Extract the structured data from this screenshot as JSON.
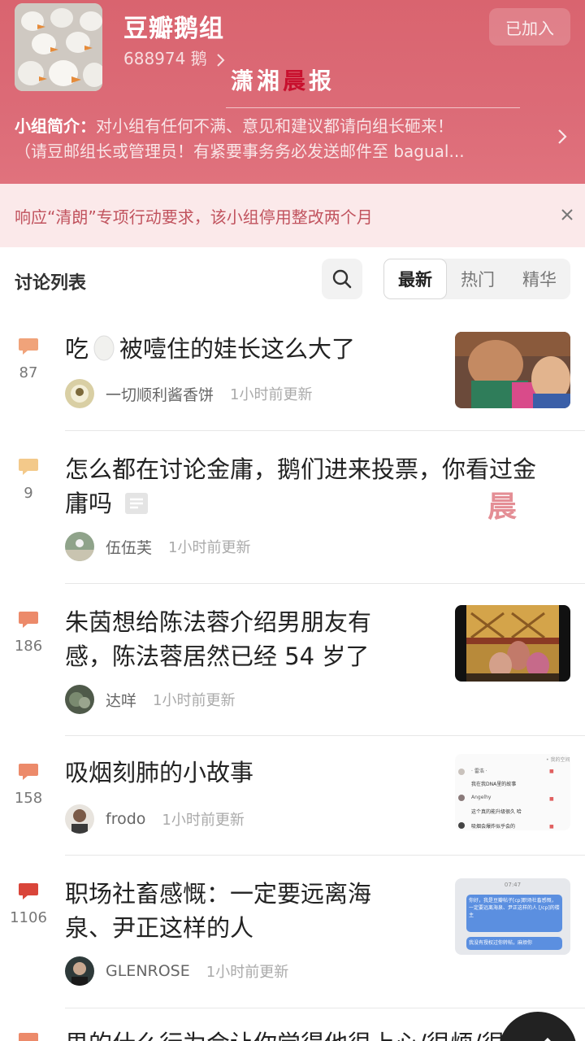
{
  "colors": {
    "header": "#dc6b77",
    "accent_red": "#c8102e",
    "comment_orange": "#f0a37a",
    "comment_red": "#d9453a"
  },
  "header": {
    "group_name": "豆瓣鹅组",
    "member_count": "688974 鹅",
    "joined_label": "已加入",
    "watermark": {
      "part1": "潇湘",
      "part2": "晨",
      "part3": "报"
    },
    "intro_label": "小组简介：",
    "intro_line1": "对小组有任何不满、意见和建议都请向组长砸来！",
    "intro_line2": "（请豆邮组长或管理员！有紧要事务务必发送邮件至 bagual..."
  },
  "notice": {
    "text": "响应“清朗”专项行动要求，该小组停用整改两个月",
    "close_icon": "close-icon"
  },
  "discussion": {
    "title": "讨论列表",
    "search_icon": "search-icon",
    "tabs": [
      {
        "label": "最新"
      },
      {
        "label": "热门"
      },
      {
        "label": "精华"
      }
    ]
  },
  "posts": [
    {
      "count": "87",
      "title_a": "吃",
      "title_b": "被噎住的娃长这么大了",
      "author": "一切顺利酱香饼",
      "updated": "1小时前更新"
    },
    {
      "count": "9",
      "title_line1": "怎么都在讨论金庸，鹅们进来投票，你看过金",
      "title_line2": "庸吗",
      "author": "伍伍芙",
      "updated": "1小时前更新"
    },
    {
      "count": "186",
      "title_line1": "朱茵想给陈法蓉介绍男朋友有",
      "title_line2": "感，陈法蓉居然已经 54 岁了",
      "author": "达咩",
      "updated": "1小时前更新"
    },
    {
      "count": "158",
      "title": "吸烟刻肺的小故事",
      "author": "frodo",
      "updated": "1小时前更新",
      "thumb": {
        "header": "• 我的空间",
        "name1": "· 雷浩 ·",
        "msg1": "我在我DNA里的故事",
        "name2": "Angelhy",
        "msg2": "这个真的能升级很久 哈",
        "msg3": "吸烟会爆炸似乎会的"
      }
    },
    {
      "count": "1106",
      "title_line1": "职场社畜感慨：一定要远离海",
      "title_line2": "泉、尹正这样的人",
      "author": "GLENROSE",
      "updated": "1小时前更新",
      "thumb": {
        "time": "07:47",
        "bubble1": "你好，我是豆瓣帖子[cp]职场社畜感慨，一定要远离海泉、尹正这样的人 [/cp]的楼主",
        "bubble2": "我没有授权过你转帖，麻烦你"
      }
    },
    {
      "title": "男的什么行为会让你觉得他很上心/很烦/很"
    }
  ],
  "watermark_mid": "晨"
}
